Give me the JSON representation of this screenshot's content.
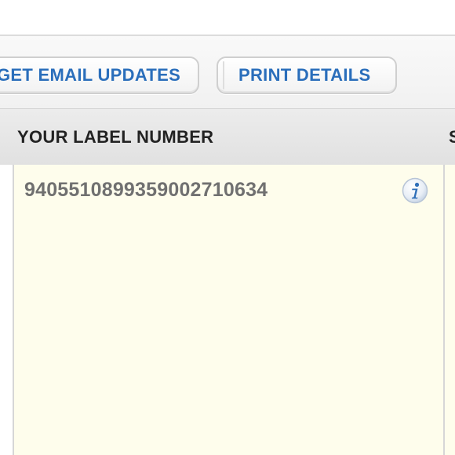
{
  "toolbar": {
    "email_updates_label": "GET EMAIL UPDATES",
    "print_details_label": "PRINT DETAILS"
  },
  "table": {
    "headers": {
      "label_number": "YOUR LABEL NUMBER",
      "next_column_partial": "S"
    },
    "rows": [
      {
        "label_number": "9405510899359002710634",
        "info_icon": "info-icon"
      }
    ]
  },
  "colors": {
    "button_text": "#2a6ebb",
    "row_background": "#fefdec",
    "header_background": "#e6e6e6",
    "label_number_text": "#707070"
  }
}
